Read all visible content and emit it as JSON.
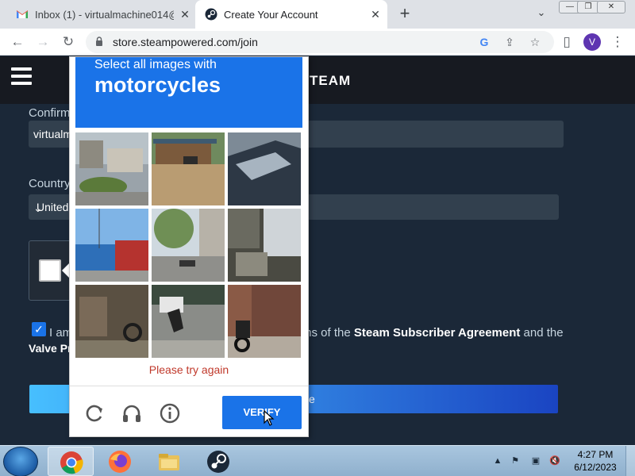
{
  "browser": {
    "tabs": [
      {
        "title": "Inbox (1) - virtualmachine014@g",
        "icon": "gmail-icon",
        "active": false
      },
      {
        "title": "Create Your Account",
        "icon": "steam-icon",
        "active": true
      }
    ],
    "url": "store.steampowered.com/join",
    "profile_initial": "V"
  },
  "steam": {
    "logo_text": "TEAM",
    "confirm_email_label": "Confirm",
    "confirm_email_value": "virtualm",
    "country_label": "Country",
    "country_value": "United",
    "agree_prefix": "I am",
    "agree_middle": "ms of the ",
    "agreement_link": "Steam Subscriber Agreement",
    "agree_and": " and the",
    "agree_line2": "Valve Pr",
    "continue_label": "e",
    "agree_checked": true
  },
  "recaptcha": {
    "instruction": "Select all images with",
    "target": "motorcycles",
    "error": "Please try again",
    "verify_label": "VERIFY",
    "icons": [
      "reload-icon",
      "audio-challenge-icon",
      "info-icon"
    ]
  },
  "taskbar": {
    "apps": [
      "chrome-icon",
      "firefox-icon",
      "file-explorer-icon",
      "steam-icon"
    ],
    "active_app": "chrome-icon",
    "time": "4:27 PM",
    "date": "6/12/2023"
  },
  "colors": {
    "recaptcha_blue": "#1a73e8",
    "steam_bg": "#1b2838",
    "steam_header": "#171a21",
    "error_red": "#c0392b"
  }
}
